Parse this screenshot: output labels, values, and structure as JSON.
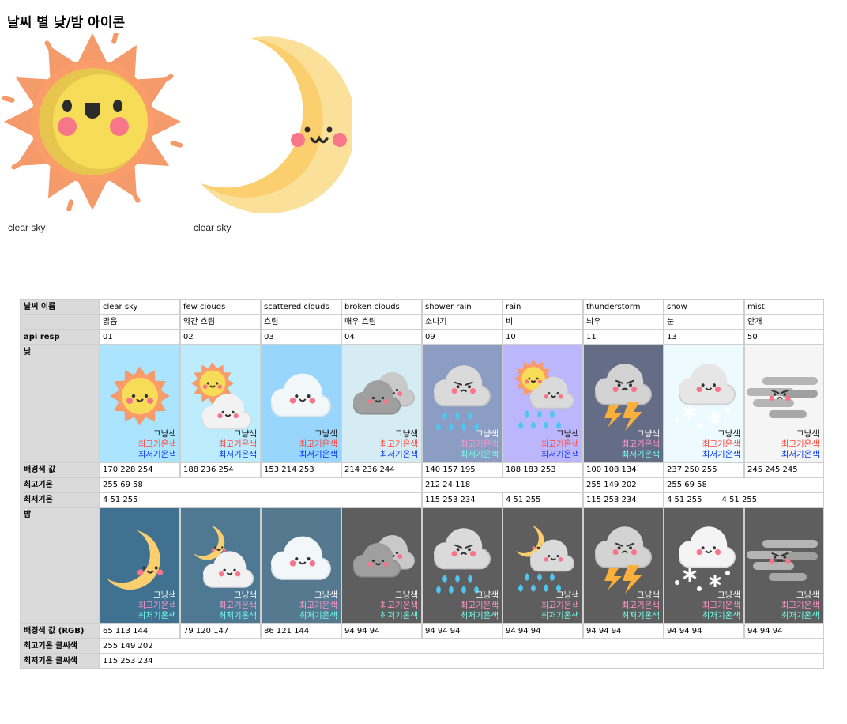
{
  "page_title": "날씨 별 낮/밤 아이콘",
  "hero": [
    {
      "icon": "sun-icon",
      "caption": "clear sky"
    },
    {
      "icon": "moon-icon",
      "caption": "clear sky"
    }
  ],
  "row_labels": {
    "name": "날씨 이름",
    "api": "api resp",
    "day": "낮",
    "day_bg": "배경색 값",
    "max_temp": "최고기온",
    "min_temp": "최저기온",
    "night": "밤",
    "night_bg": "배경색 값 (RGB)",
    "max_text_color": "최고기온 글씨색",
    "min_text_color": "최저기온 글씨색"
  },
  "legend": {
    "plain": "그냥색",
    "max": "최고기온색",
    "min": "최저기온색"
  },
  "columns": [
    {
      "name": "clear sky",
      "korean": "맑음",
      "api": "01",
      "day_icon": "sun-icon",
      "night_icon": "moon-icon",
      "day_bg": "170 228 254",
      "night_bg": "65 113 144",
      "day_color": "#aae4fe",
      "night_color": "#417190"
    },
    {
      "name": "few clouds",
      "korean": "약간 흐림",
      "api": "02",
      "day_icon": "sun-cloud-icon",
      "night_icon": "moon-cloud-icon",
      "day_bg": "188 236 254",
      "night_bg": "79 120 147",
      "day_color": "#bcecfe",
      "night_color": "#4f7893"
    },
    {
      "name": "scattered clouds",
      "korean": "흐림",
      "api": "03",
      "day_icon": "cloud-icon",
      "night_icon": "cloud-icon",
      "day_bg": "153 214 253",
      "night_bg": "86 121 144",
      "day_color": "#99d6fd",
      "night_color": "#567990"
    },
    {
      "name": "broken clouds",
      "korean": "매우 흐림",
      "api": "04",
      "day_icon": "broken-clouds-icon",
      "night_icon": "broken-clouds-icon",
      "day_bg": "214 236 244",
      "night_bg": "94 94 94",
      "day_color": "#d6ecf4",
      "night_color": "#5e5e5e"
    },
    {
      "name": "shower rain",
      "korean": "소나기",
      "api": "09",
      "day_icon": "shower-rain-icon",
      "night_icon": "shower-rain-icon",
      "day_bg": "140 157 195",
      "night_bg": "94 94 94",
      "day_color": "#8c9dc3",
      "night_color": "#5e5e5e"
    },
    {
      "name": "rain",
      "korean": "비",
      "api": "10",
      "day_icon": "sun-rain-icon",
      "night_icon": "moon-rain-icon",
      "day_bg": "188 183 253",
      "night_bg": "94 94 94",
      "day_color": "#bcb7fd",
      "night_color": "#5e5e5e"
    },
    {
      "name": "thunderstorm",
      "korean": "뇌우",
      "api": "11",
      "day_icon": "thunderstorm-icon",
      "night_icon": "thunderstorm-icon",
      "day_bg": "100 108 134",
      "night_bg": "94 94 94",
      "day_color": "#646c86",
      "night_color": "#5e5e5e"
    },
    {
      "name": "snow",
      "korean": "눈",
      "api": "13",
      "day_icon": "snow-icon",
      "night_icon": "snow-icon",
      "day_bg": "237 250 255",
      "night_bg": "94 94 94",
      "day_color": "#edfaff",
      "night_color": "#5e5e5e"
    },
    {
      "name": "mist",
      "korean": "안개",
      "api": "50",
      "day_icon": "mist-icon",
      "night_icon": "mist-icon",
      "day_bg": "245 245 245",
      "night_bg": "94 94 94",
      "day_color": "#f5f5f5",
      "night_color": "#5e5e5e"
    }
  ],
  "max_temp_row": {
    "a": "255 69 58",
    "b": "212 24 118",
    "c": "255 149 202",
    "d": "255 69 58"
  },
  "min_temp_row": {
    "a": "4 51 255",
    "b": "115 253 234",
    "c": "4 51 255",
    "d": "115 253 234",
    "e": "4 51 255",
    "f": "4 51 255"
  },
  "max_text_color_value": "255 149 202",
  "min_text_color_value": "115 253 234"
}
